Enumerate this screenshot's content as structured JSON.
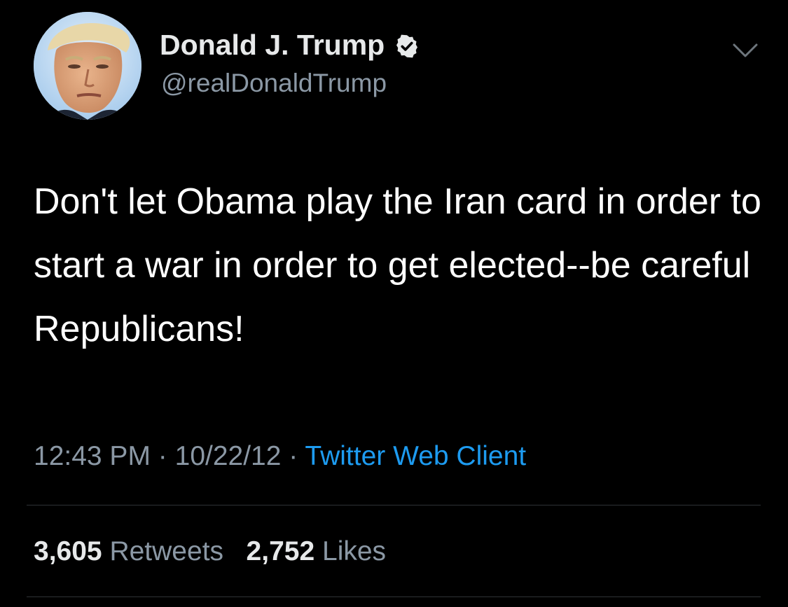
{
  "author": {
    "name": "Donald J. Trump",
    "handle": "@realDonaldTrump",
    "verified": true,
    "avatar_icon": "profile-photo"
  },
  "tweet": {
    "text": "Don't let Obama play the Iran card in order to start a war in order to get elected--be careful Republicans!"
  },
  "meta": {
    "time": "12:43 PM",
    "separator": "·",
    "date": "10/22/12",
    "source": "Twitter Web Client"
  },
  "stats": {
    "retweets_count": "3,605",
    "retweets_label": "Retweets",
    "likes_count": "2,752",
    "likes_label": "Likes"
  },
  "colors": {
    "background": "#000000",
    "text": "#ffffff",
    "secondary": "#8b98a5",
    "link": "#1d9bf0"
  },
  "icons": {
    "verified": "verified-badge-icon",
    "menu": "chevron-down-icon"
  }
}
